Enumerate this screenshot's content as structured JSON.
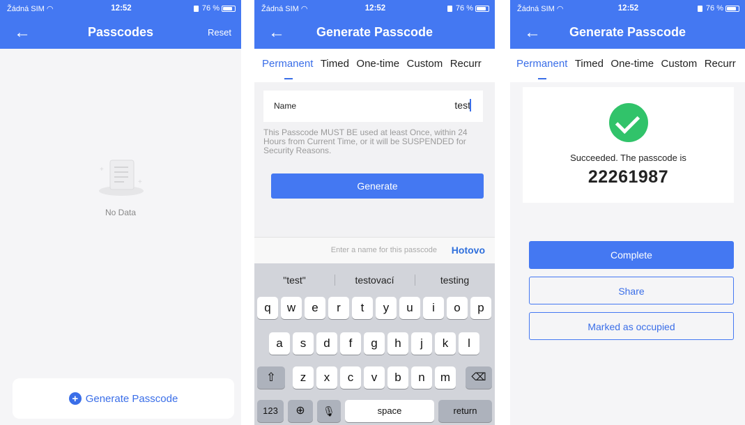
{
  "status": {
    "carrier": "Žádná SIM",
    "time": "12:52",
    "battery": "76 %"
  },
  "screen1": {
    "title": "Passcodes",
    "reset_label": "Reset",
    "empty_text": "No Data",
    "generate_label": "Generate Passcode"
  },
  "screen2": {
    "title": "Generate Passcode",
    "tabs": [
      "Permanent",
      "Timed",
      "One-time",
      "Custom",
      "Recurr"
    ],
    "active_tab": "Permanent",
    "name_label": "Name",
    "name_value": "test",
    "notice": "This Passcode MUST BE used at least Once, within 24 Hours from Current Time, or it will be SUSPENDED for Security Reasons.",
    "generate_button": "Generate",
    "input_hint": "Enter a name for this passcode",
    "done_label": "Hotovo",
    "suggestions": [
      "\"test\"",
      "testovací",
      "testing"
    ],
    "keys_row1": [
      "q",
      "w",
      "e",
      "r",
      "t",
      "y",
      "u",
      "i",
      "o",
      "p"
    ],
    "keys_row2": [
      "a",
      "s",
      "d",
      "f",
      "g",
      "h",
      "j",
      "k",
      "l"
    ],
    "keys_row3": [
      "z",
      "x",
      "c",
      "v",
      "b",
      "n",
      "m"
    ],
    "key_numbers": "123",
    "key_space": "space",
    "key_return": "return"
  },
  "screen3": {
    "title": "Generate Passcode",
    "tabs": [
      "Permanent",
      "Timed",
      "One-time",
      "Custom",
      "Recurr"
    ],
    "active_tab": "Permanent",
    "success_text": "Succeeded. The passcode is",
    "passcode": "22261987",
    "complete_button": "Complete",
    "share_button": "Share",
    "occupied_button": "Marked as occupied"
  },
  "colors": {
    "accent": "#4478f2",
    "success": "#31c36a"
  }
}
